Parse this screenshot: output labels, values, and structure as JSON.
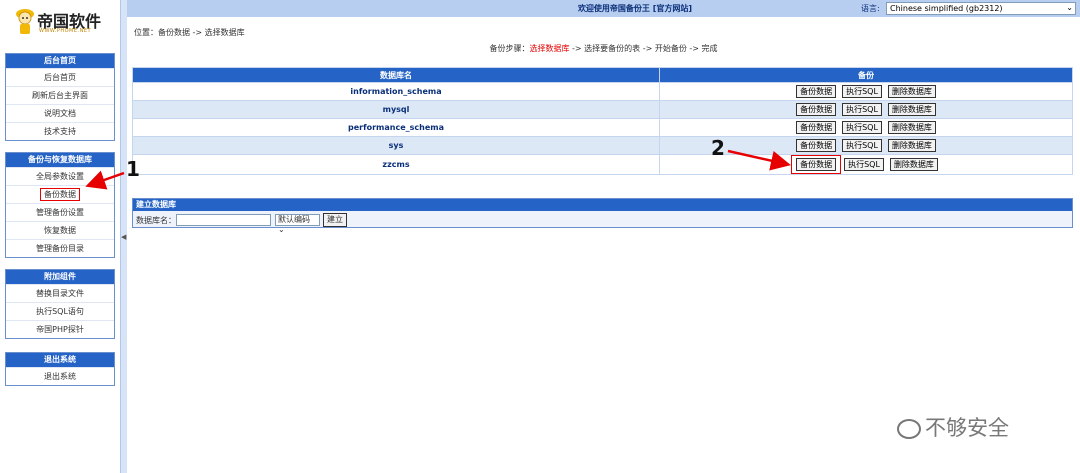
{
  "topbar": {
    "welcome": "欢迎使用帝国备份王",
    "site_link": "[官方网站]",
    "language_label": "语言:",
    "language_value": "Chinese simplified (gb2312)"
  },
  "logo": {
    "text": "帝国软件",
    "url": "WWW.PHOME.NET"
  },
  "menus": {
    "home": {
      "title": "后台首页",
      "items": [
        "后台首页",
        "刷新后台主界面",
        "说明文档",
        "技术支持"
      ]
    },
    "backup": {
      "title": "备份与恢复数据库",
      "items": [
        "全局参数设置",
        "备份数据",
        "管理备份设置",
        "恢复数据",
        "管理备份目录"
      ]
    },
    "addons": {
      "title": "附加组件",
      "items": [
        "替换目录文件",
        "执行SQL语句",
        "帝国PHP探针"
      ]
    },
    "logout": {
      "title": "退出系统",
      "items": [
        "退出系统"
      ]
    }
  },
  "main": {
    "breadcrumb": "位置：备份数据 -> 选择数据库",
    "steps_prefix": "备份步骤：",
    "steps_current": "选择数据库",
    "steps_rest": " -> 选择要备份的表 -> 开始备份 -> 完成",
    "table": {
      "col_db": "数据库名",
      "col_backup": "备份",
      "rows": [
        {
          "name": "information_schema"
        },
        {
          "name": "mysql"
        },
        {
          "name": "performance_schema"
        },
        {
          "name": "sys"
        },
        {
          "name": "zzcms"
        }
      ],
      "btn_backup": "备份数据",
      "btn_sql": "执行SQL",
      "btn_delete": "删除数据库"
    },
    "create": {
      "title": "建立数据库",
      "label": "数据库名：",
      "input_value": "",
      "select_value": "默认编码",
      "button": "建立"
    }
  },
  "annotations": {
    "step1": "1",
    "step2": "2",
    "color": "#e60000"
  },
  "watermark": "不够安全"
}
